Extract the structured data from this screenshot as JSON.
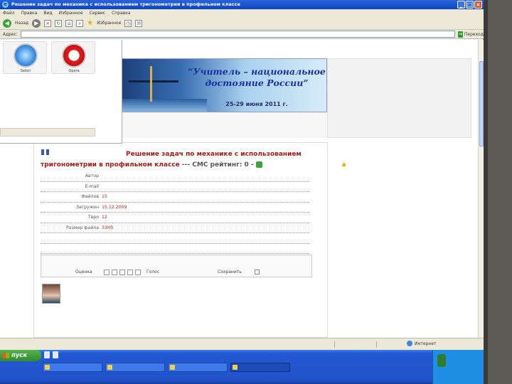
{
  "window": {
    "title": "Решение задач по механике с использованием тригонометрии в профильном классе",
    "menu": [
      "Файл",
      "Правка",
      "Вид",
      "Избранное",
      "Сервис",
      "Справка"
    ],
    "toolbar": {
      "back_label": "Назад",
      "favorites_label": "Избранное"
    },
    "address": {
      "label": "Адрес:",
      "url": "",
      "go_label": "Переход"
    }
  },
  "overlay": {
    "icons": [
      {
        "name": "safari",
        "label": "Safari"
      },
      {
        "name": "opera",
        "label": "Opera"
      }
    ],
    "strip_text": ""
  },
  "banner": {
    "title_line1": "“Учитель – национальное",
    "title_line2": "достояние России”",
    "dates": "25-29 июня 2011 г."
  },
  "article": {
    "tags": [
      "",
      ""
    ],
    "title_main": "Решение задач по механике с использованием тригонометрии в профильном классе",
    "rating_text": "--- СМС рейтинг: 0 -",
    "meta": [
      {
        "key": "Автор",
        "value": ""
      },
      {
        "key": "E-mail",
        "value": ""
      },
      {
        "key": "Файлов",
        "value": "15"
      },
      {
        "key": "Загружен",
        "value": "15.12.2009"
      },
      {
        "key": "Твро",
        "value": "12"
      },
      {
        "key": "Размер файла",
        "value": "33Кб"
      }
    ],
    "meta_wide": [
      {
        "key": "",
        "value": ""
      },
      {
        "key": "",
        "value": ""
      }
    ],
    "actions": {
      "links": [
        "",
        "",
        "",
        "",
        "",
        "",
        ""
      ],
      "sub_link": "",
      "rate_label": "Оценка",
      "vote_label": "Голос",
      "save_label": "Сохранить"
    }
  },
  "comment": {
    "lines": [
      "",
      "",
      "",
      "",
      "",
      "",
      "",
      ""
    ]
  },
  "statusbar": {
    "left": "",
    "zone": "Интернет"
  },
  "taskbar": {
    "start_label": "пуск",
    "tasks": [
      "",
      "",
      "",
      ""
    ],
    "tray": {
      "time": "",
      "day": "",
      "date": ""
    }
  }
}
